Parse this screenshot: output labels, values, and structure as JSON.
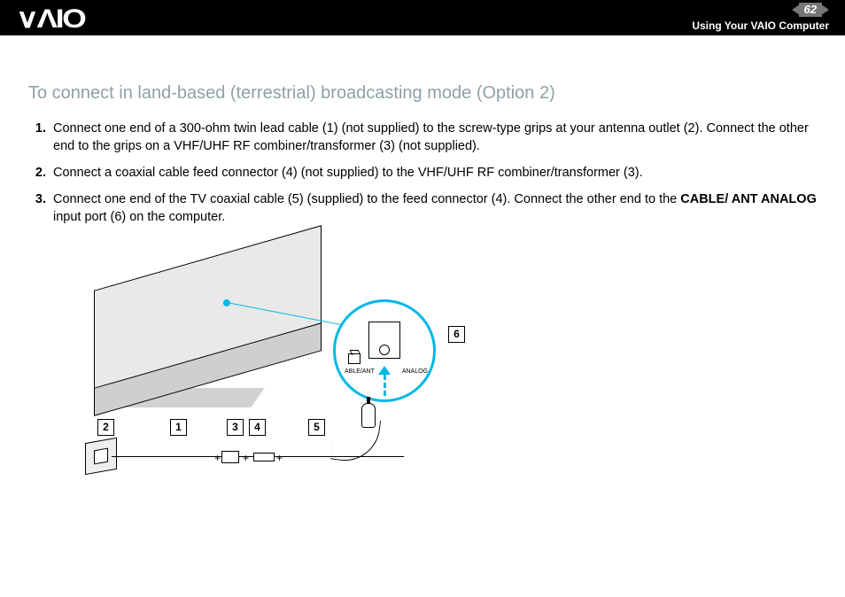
{
  "header": {
    "logo": "∨ΛIO",
    "page_number": "62",
    "section": "Using Your VAIO Computer"
  },
  "title": "To connect in land-based (terrestrial) broadcasting mode (Option 2)",
  "steps": [
    "Connect one end of a 300-ohm twin lead cable (1) (not supplied) to the screw-type grips at your antenna outlet (2). Connect the other end to the grips on a VHF/UHF RF combiner/transformer (3) (not supplied).",
    "Connect a coaxial cable feed connector (4) (not supplied) to the VHF/UHF RF combiner/transformer (3).",
    "Connect one end of the TV coaxial cable (5) (supplied) to the feed connector (4). Connect the other end to the CABLE/ ANT ANALOG input port (6) on the computer."
  ],
  "step3_tail_bold": "CABLE/ ANT ANALOG",
  "step3_tail_plain": " input port (6) on the computer.",
  "step3_head": "Connect one end of the TV coaxial cable (5) (supplied) to the feed connector (4). Connect the other end to the ",
  "diagram": {
    "callouts": {
      "1": "1",
      "2": "2",
      "3": "3",
      "4": "4",
      "5": "5",
      "6": "6"
    },
    "port_label_left": "ABLE/ANT",
    "port_label_right": "ANALOG"
  }
}
